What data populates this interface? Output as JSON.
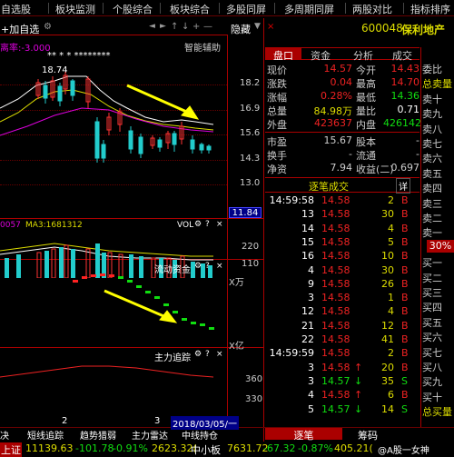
{
  "top_tabs": [
    "自选股",
    "板块监测",
    "个股综合",
    "板块综合",
    "多股同屏",
    "多周期同屏",
    "两股对比",
    "指标排序"
  ],
  "sub": {
    "left": "+加自选",
    "gear": "⚙",
    "nav": [
      "◄",
      "►",
      "↑",
      "↓",
      "+",
      "—"
    ],
    "hide": "隐藏",
    "tabs": [
      "盘口",
      "资金",
      "分析",
      "成交"
    ],
    "code": "600048",
    "name": "保利地产"
  },
  "main_chart": {
    "indicator_label": "离率:-3.000",
    "assist": "智能辅助",
    "high_label": "18.74",
    "marks": "** * *     ********",
    "yticks": [
      "18.2",
      "16.9",
      "15.6",
      "14.3",
      "13.0"
    ],
    "price_box": "11.84"
  },
  "vol_chart": {
    "label_a": "0057",
    "label_b": "MA3:1681312",
    "label_c": "VOL",
    "yticks": [
      "220",
      "110"
    ],
    "unit": "X万"
  },
  "fund_chart": {
    "label": "流动资金",
    "unit": "X亿"
  },
  "main_track": {
    "label": "主力追踪",
    "yticks": [
      "360",
      "330"
    ]
  },
  "quote": {
    "rows": [
      {
        "l1": "现价",
        "v1": "14.57",
        "l2": "今开",
        "v2": "14.43",
        "c1": "red",
        "c2": "red"
      },
      {
        "l1": "涨跌",
        "v1": "0.04",
        "l2": "最高",
        "v2": "14.70",
        "c1": "red",
        "c2": "red"
      },
      {
        "l1": "涨幅",
        "v1": "0.28%",
        "l2": "最低",
        "v2": "14.36",
        "c1": "red",
        "c2": "grn"
      },
      {
        "l1": "总量",
        "v1": "84.98万",
        "l2": "量比",
        "v2": "0.71",
        "c1": "yel",
        "c2": "wht"
      },
      {
        "l1": "外盘",
        "v1": "423637",
        "l2": "内盘",
        "v2": "426142",
        "c1": "red",
        "c2": "grn"
      }
    ],
    "rows2": [
      {
        "l1": "市盈",
        "v1": "15.67",
        "l2": "股本",
        "v2": "-"
      },
      {
        "l1": "换手",
        "v1": "-",
        "l2": "流通",
        "v2": "-"
      },
      {
        "l1": "净资",
        "v1": "7.94",
        "l2": "收益(二)",
        "v2": "0.697"
      }
    ]
  },
  "trades_header": "逐笔成交",
  "detail_label": "详",
  "trades": [
    {
      "t": "14:59:58",
      "p": "14.58",
      "v": "2",
      "f": "B"
    },
    {
      "t": "13",
      "p": "14.58",
      "v": "30",
      "f": "B"
    },
    {
      "t": "14",
      "p": "14.58",
      "v": "4",
      "f": "B"
    },
    {
      "t": "15",
      "p": "14.58",
      "v": "5",
      "f": "B"
    },
    {
      "t": "16",
      "p": "14.58",
      "v": "10",
      "f": "B"
    },
    {
      "t": "4",
      "p": "14.58",
      "v": "30",
      "f": "B"
    },
    {
      "t": "9",
      "p": "14.58",
      "v": "26",
      "f": "B"
    },
    {
      "t": "3",
      "p": "14.58",
      "v": "1",
      "f": "B"
    },
    {
      "t": "12",
      "p": "14.58",
      "v": "4",
      "f": "B"
    },
    {
      "t": "21",
      "p": "14.58",
      "v": "12",
      "f": "B"
    },
    {
      "t": "22",
      "p": "14.58",
      "v": "41",
      "f": "B"
    },
    {
      "t": "14:59:59",
      "p": "14.58",
      "v": "2",
      "f": "B"
    },
    {
      "t": "3",
      "p": "14.58",
      "v": "20",
      "f": "B"
    },
    {
      "t": "3",
      "p": "14.57",
      "v": "35",
      "f": "S"
    },
    {
      "t": "4",
      "p": "14.58",
      "v": "6",
      "f": "B"
    },
    {
      "t": "5",
      "p": "14.57",
      "v": "14",
      "f": "S"
    }
  ],
  "side_labels": [
    "委比",
    "总卖量",
    "卖十",
    "卖九",
    "卖八",
    "卖七",
    "卖六",
    "卖五",
    "卖四",
    "卖三",
    "卖二",
    "卖一",
    "30%",
    "买一",
    "买二",
    "买三",
    "买四",
    "买五",
    "买六",
    "买七",
    "买八",
    "买九",
    "买十",
    "总买量"
  ],
  "bottom": {
    "n2": "2",
    "n3": "3",
    "date": "2018/03/05/一",
    "tabs": [
      "逐笔",
      "筹码"
    ],
    "left_tabs": [
      "决",
      "短线追踪",
      "趋势猎弱",
      "主力雷达",
      "中线持仓"
    ]
  },
  "ticker": [
    {
      "l": "上证",
      "v": "11139.63",
      "c": "-101.78",
      "p": "-0.91%",
      "x": "2623.32("
    },
    {
      "l": "中小板",
      "v": "7631.72",
      "c": "-67.32",
      "p": "-0.87%",
      "x": "405.21("
    }
  ],
  "watermark": "@A股一女神"
}
